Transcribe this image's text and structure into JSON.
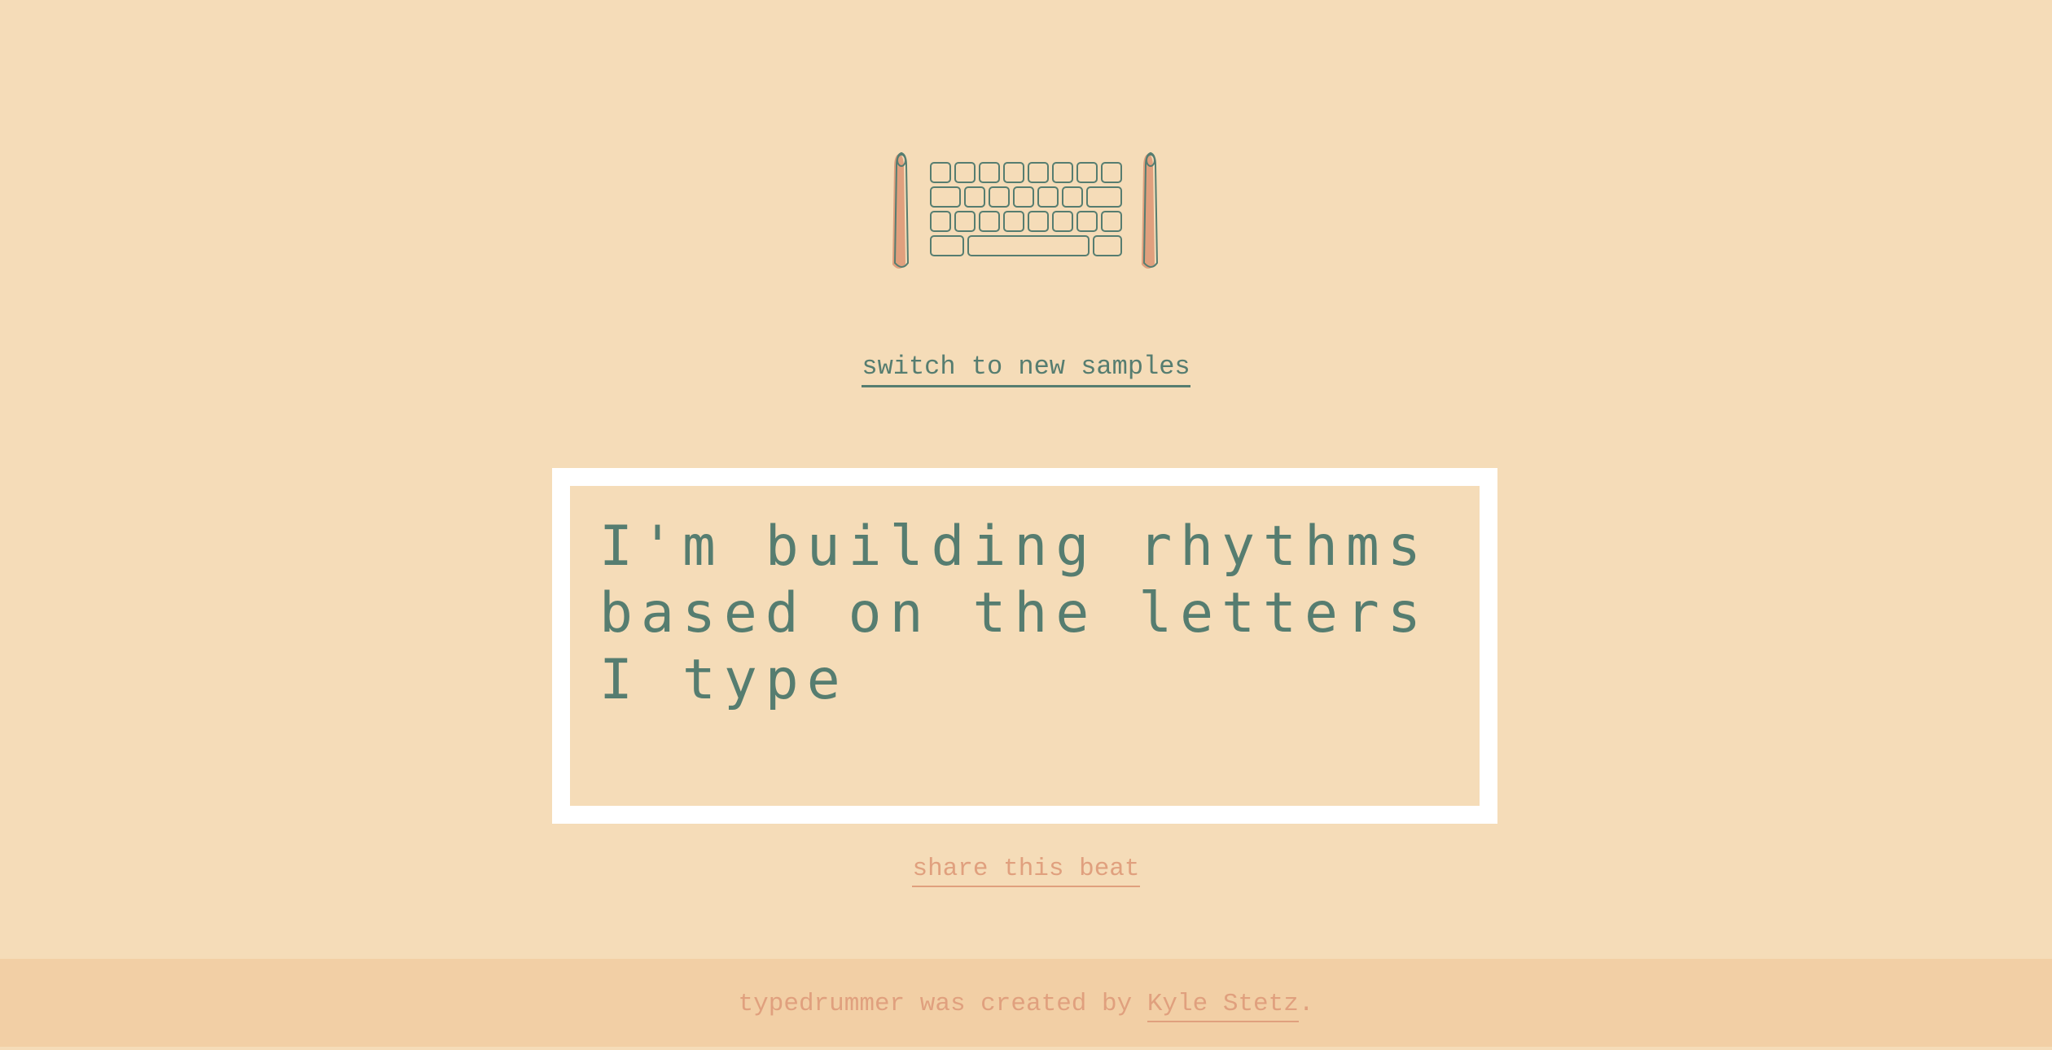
{
  "switch_link": "switch to new samples",
  "editor_text": "I'm building rhythms based on the letters I type",
  "share_link": "share this beat",
  "footer": {
    "prefix": "typedrummer was created by ",
    "author": "Kyle Stetz",
    "suffix": "."
  },
  "colors": {
    "background": "#f5dcb8",
    "footer_background": "#f2cfa5",
    "primary_text": "#567d70",
    "accent": "#e0a07e",
    "frame": "#ffffff"
  },
  "icons": {
    "logo": "keyboard-with-drumsticks-icon"
  }
}
